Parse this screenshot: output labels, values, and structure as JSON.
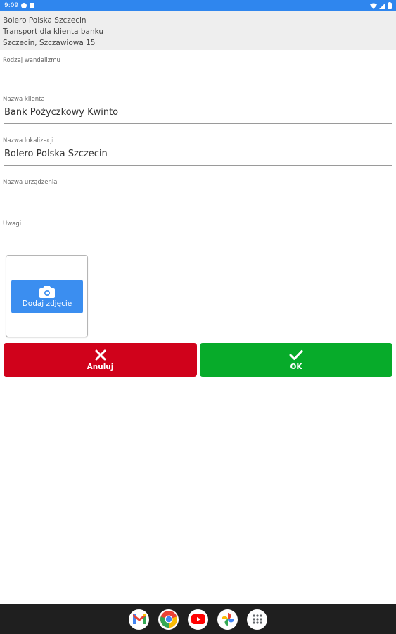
{
  "status_bar": {
    "time": "9:09",
    "icons": [
      "notification-icon",
      "sim-icon",
      "wifi-icon",
      "signal-icon",
      "battery-icon"
    ],
    "color": "#2f86ee"
  },
  "header": {
    "line1": "Bolero Polska Szczecin",
    "line2": "Transport dla klienta banku",
    "line3": "Szczecin, Szczawiowa 15"
  },
  "form": {
    "vandalism_type": {
      "label": "Rodzaj wandalizmu",
      "value": ""
    },
    "client_name": {
      "label": "Nazwa klienta",
      "value": "Bank Pożyczkowy Kwinto"
    },
    "location_name": {
      "label": "Nazwa lokalizacji",
      "value": "Bolero Polska Szczecin"
    },
    "device_name": {
      "label": "Nazwa urządzenia",
      "value": ""
    },
    "notes": {
      "label": "Uwagi",
      "value": ""
    }
  },
  "photo": {
    "add_label": "Dodaj zdjęcie",
    "icon": "camera-icon",
    "color": "#3b8ef0"
  },
  "actions": {
    "cancel_label": "Anuluj",
    "ok_label": "OK",
    "cancel_color": "#d0021b",
    "ok_color": "#07ab2a"
  },
  "dock": {
    "apps": [
      "gmail-icon",
      "chrome-icon",
      "youtube-icon",
      "photos-icon",
      "app-drawer-icon"
    ]
  }
}
